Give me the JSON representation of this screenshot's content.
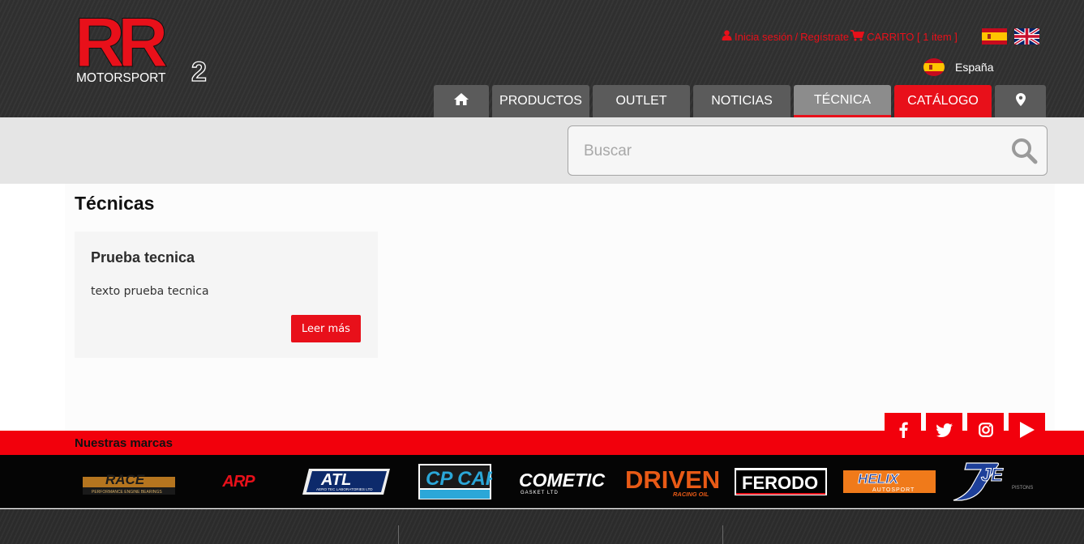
{
  "header": {
    "logo": {
      "letters": "RR",
      "sub": "MOTORSPORT",
      "number": "2"
    },
    "user_links": {
      "login": "Inicia sesión",
      "separator": "/",
      "register": "Regístrate",
      "cart": "CARRITO [ 1 item ]"
    },
    "country": "España",
    "nav": [
      {
        "label": "",
        "icon": "home-icon"
      },
      {
        "label": "PRODUCTOS"
      },
      {
        "label": "OUTLET"
      },
      {
        "label": "NOTICIAS"
      },
      {
        "label": "TÉCNICA",
        "active": true
      },
      {
        "label": "CATÁLOGO",
        "highlight": true
      },
      {
        "label": "",
        "icon": "location-pin-icon"
      }
    ]
  },
  "search": {
    "placeholder": "Buscar"
  },
  "main": {
    "title": "Técnicas",
    "card": {
      "title": "Prueba tecnica",
      "text": "texto prueba tecnica",
      "button": "Leer más"
    }
  },
  "brands": {
    "title": "Nuestras marcas",
    "items": [
      "RACE",
      "ARP",
      "ATL",
      "CP CARRILLO",
      "COMETIC",
      "DRIVEN",
      "FERODO",
      "HELIX",
      "JE"
    ],
    "sublabels": {
      "race": "PERFORMANCE ENGINE BEARINGS",
      "atl": "AERO TEC LABORATORIES LTD",
      "cometic": "GASKET LTD",
      "driven": "RACING OIL",
      "helix": "AUTOSPORT",
      "je": "PISTONS"
    }
  },
  "social": [
    "facebook-icon",
    "twitter-icon",
    "instagram-icon",
    "youtube-icon"
  ],
  "colors": {
    "accent": "#e8101a",
    "header_bg": "#2f2f2f",
    "nav_bg": "#5b5b5b",
    "nav_active": "#8c8c8c",
    "search_strip": "#e5e5e5"
  }
}
